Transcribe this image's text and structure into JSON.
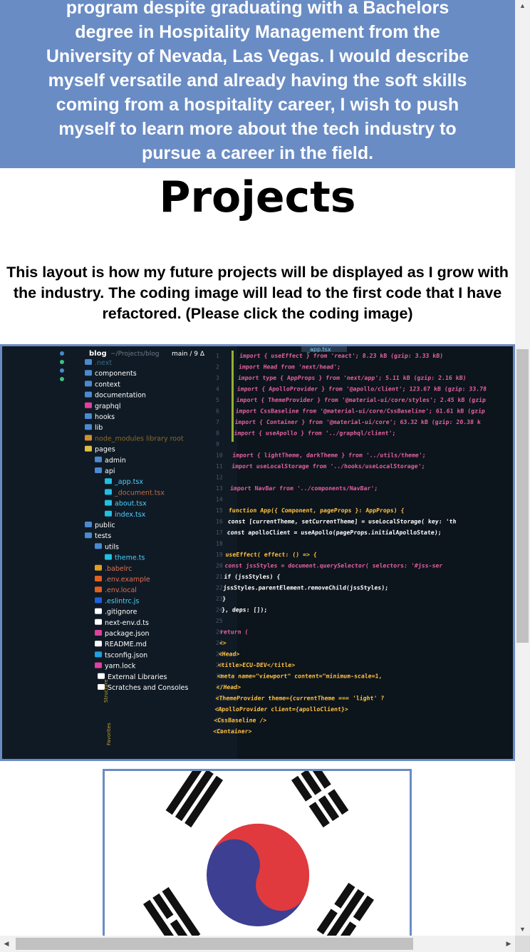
{
  "about": {
    "lines": [
      "program despite graduating with a Bachelors",
      "degree in Hospitality Management from the",
      "University of Nevada, Las Vegas. I would describe",
      "myself versatile and already having the soft skills",
      "coming from a hospitality career, I wish to push",
      "myself to learn more about the tech industry to",
      "pursue a career in the field."
    ]
  },
  "projects": {
    "title": "Projects",
    "description": "This layout is how my future projects will be displayed as I grow with the industry. The coding image will lead to the first code that I have refactored. (Please click the coding image)"
  },
  "code_image": {
    "tab": "_app.tsx",
    "project_header": "blog",
    "project_path": "~/Projects/blog",
    "branch": "main / 9 Δ",
    "tree": [
      ".next",
      "components",
      "context",
      "documentation",
      "graphql",
      "hooks",
      "lib",
      "node_modules  library root",
      "pages",
      "admin",
      "api",
      "_app.tsx",
      "_document.tsx",
      "about.tsx",
      "index.tsx",
      "public",
      "tests",
      "utils",
      "theme.ts",
      ".babelrc",
      ".env.example",
      ".env.local",
      ".eslintrc.js",
      ".gitignore",
      "next-env.d.ts",
      "package.json",
      "README.md",
      "tsconfig.json",
      "yarn.lock",
      "External Libraries",
      "Scratches and Consoles"
    ],
    "side_labels": [
      "Structure",
      "Favorites"
    ],
    "code_lines": [
      "import { useEffect } from 'react';  8.23 kB (gzip: 3.33 kB)",
      "import Head from 'next/head';",
      "import type { AppProps } from 'next/app';  5.11 kB (gzip: 2.16 kB)",
      "import { ApolloProvider } from '@apollo/client';  123.67 kB (gzip: 33.78",
      "import { ThemeProvider } from '@material-ui/core/styles';  2.45 kB (gzip",
      "import CssBaseline from '@material-ui/core/CssBaseline';  61.61 kB (gzip",
      "import { Container } from '@material-ui/core';  63.32 kB (gzip: 20.38 k",
      "import { useApollo } from '../graphql/client';",
      "",
      "import { lightTheme, darkTheme } from '../utils/theme';",
      "import useLocalStorage from '../hooks/useLocalStorage';",
      "",
      "import NavBar from '../components/NavBar';",
      "",
      "function App({ Component, pageProps }: AppProps) {",
      "  const [currentTheme, setCurrentTheme] = useLocalStorage( key: 'th",
      "  const apolloClient = useApollo(pageProps.initialApolloState);",
      "",
      "  useEffect( effect: () => {",
      "    const jssStyles = document.querySelector( selectors: '#jss-ser",
      "    if (jssStyles) {",
      "      jssStyles.parentElement.removeChild(jssStyles);",
      "    }",
      "  },  deps: []);",
      "",
      "  return (",
      "    <>",
      "      <Head>",
      "        <title>ECU-DEV</title>",
      "        <meta name=\"viewport\" content=\"minimum-scale=1,",
      "      </Head>",
      "      <ThemeProvider theme={currentTheme === 'light' ?",
      "        <ApolloProvider client={apolloClient}>",
      "          <CssBaseline />",
      "          <Container>"
    ]
  },
  "flag_image": {
    "colors": {
      "red": "#e03a3e",
      "blue": "#3c3f92",
      "black": "#111111"
    }
  },
  "colors": {
    "accent": "#6a8cc4"
  }
}
